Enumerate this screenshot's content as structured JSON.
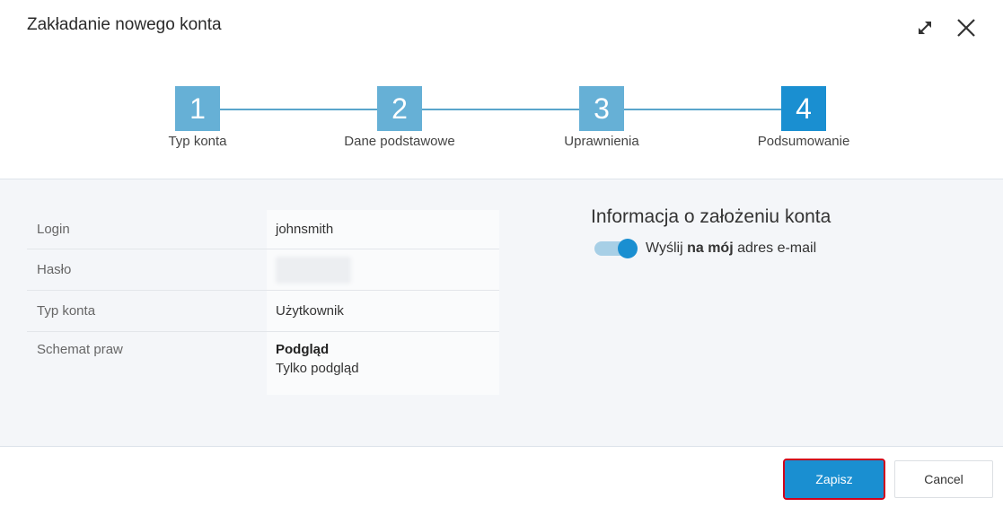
{
  "dialog": {
    "title": "Zakładanie nowego konta"
  },
  "stepper": {
    "steps": [
      {
        "number": "1",
        "label": "Typ konta",
        "active": false
      },
      {
        "number": "2",
        "label": "Dane podstawowe",
        "active": false
      },
      {
        "number": "3",
        "label": "Uprawnienia",
        "active": false
      },
      {
        "number": "4",
        "label": "Podsumowanie",
        "active": true
      }
    ]
  },
  "summary": {
    "rows": [
      {
        "label": "Login",
        "value": "johnsmith"
      },
      {
        "label": "Hasło",
        "value": ""
      },
      {
        "label": "Typ konta",
        "value": "Użytkownik"
      },
      {
        "label": "Schemat praw",
        "value": "Podgląd",
        "subvalue": "Tylko podgląd"
      }
    ]
  },
  "info": {
    "title": "Informacja o założeniu konta",
    "toggle_prefix": "Wyślij",
    "toggle_bold": "na mój",
    "toggle_suffix": "adres e-mail",
    "toggle_on": true
  },
  "footer": {
    "save_label": "Zapisz",
    "cancel_label": "Cancel"
  },
  "colors": {
    "accent": "#1a8fd1",
    "step_inactive": "#66b0d6",
    "highlight_border": "#d0021b"
  }
}
